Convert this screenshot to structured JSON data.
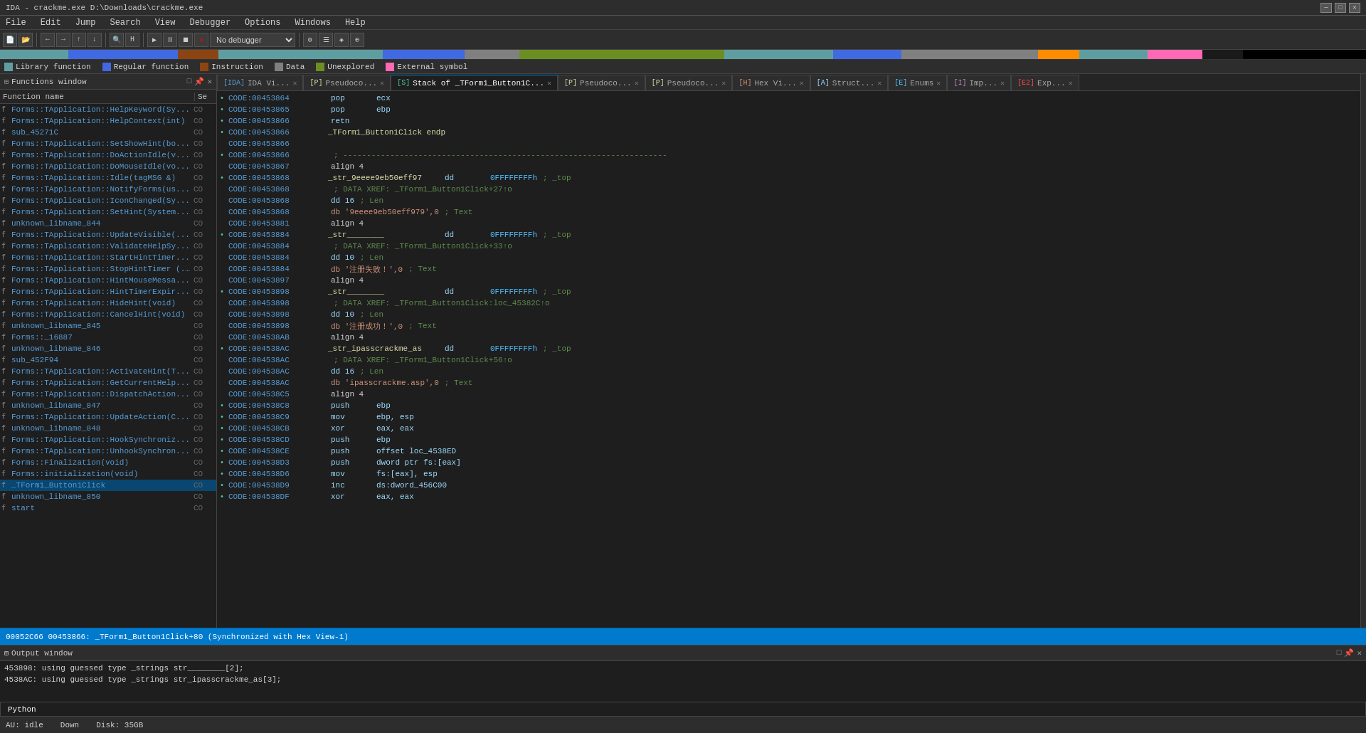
{
  "titlebar": {
    "title": "IDA - crackme.exe D:\\Downloads\\crackme.exe",
    "min": "─",
    "max": "□",
    "close": "✕"
  },
  "menubar": {
    "items": [
      "File",
      "Edit",
      "Jump",
      "Search",
      "View",
      "Debugger",
      "Options",
      "Windows",
      "Help"
    ]
  },
  "legend": {
    "items": [
      {
        "color": "#5f9ea0",
        "label": "Library function"
      },
      {
        "color": "#4169e1",
        "label": "Regular function"
      },
      {
        "color": "#8b4513",
        "label": "Instruction"
      },
      {
        "color": "#808080",
        "label": "Data"
      },
      {
        "color": "#6b8e23",
        "label": "Unexplored"
      },
      {
        "color": "#ff69b4",
        "label": "External symbol"
      }
    ]
  },
  "functions_panel": {
    "title": "Functions window",
    "col_name": "Function name",
    "col_se": "Se",
    "functions": [
      {
        "icon": "f",
        "name": "Forms::TApplication::HelpKeyword(Sy...",
        "se": "CO"
      },
      {
        "icon": "f",
        "name": "Forms::TApplication::HelpContext(int)",
        "se": "CO"
      },
      {
        "icon": "f",
        "name": "sub_45271C",
        "se": "CO"
      },
      {
        "icon": "f",
        "name": "Forms::TApplication::SetShowHint(bo...",
        "se": "CO"
      },
      {
        "icon": "f",
        "name": "Forms::TApplication::DoActionIdle(v...",
        "se": "CO"
      },
      {
        "icon": "f",
        "name": "Forms::TApplication::DoMouseIdle(vo...",
        "se": "CO"
      },
      {
        "icon": "f",
        "name": "Forms::TApplication::Idle(tagMSG &)",
        "se": "CO"
      },
      {
        "icon": "f",
        "name": "Forms::TApplication::NotifyForms(us...",
        "se": "CO"
      },
      {
        "icon": "f",
        "name": "Forms::TApplication::IconChanged(Sy...",
        "se": "CO"
      },
      {
        "icon": "f",
        "name": "Forms::TApplication::SetHint(System...",
        "se": "CO"
      },
      {
        "icon": "f",
        "name": "unknown_libname_844",
        "se": "CO"
      },
      {
        "icon": "f",
        "name": "Forms::TApplication::UpdateVisible(...",
        "se": "CO"
      },
      {
        "icon": "f",
        "name": "Forms::TApplication::ValidateHelpSy...",
        "se": "CO"
      },
      {
        "icon": "f",
        "name": "Forms::TApplication::StartHintTimer...",
        "se": "CO"
      },
      {
        "icon": "f",
        "name": "Forms::TApplication::StopHintTimer (...",
        "se": "CO"
      },
      {
        "icon": "f",
        "name": "Forms::TApplication::HintMouseMessa...",
        "se": "CO"
      },
      {
        "icon": "f",
        "name": "Forms::TApplication::HintTimerExpir...",
        "se": "CO"
      },
      {
        "icon": "f",
        "name": "Forms::TApplication::HideHint(void)",
        "se": "CO"
      },
      {
        "icon": "f",
        "name": "Forms::TApplication::CancelHint(void)",
        "se": "CO"
      },
      {
        "icon": "f",
        "name": "unknown_libname_845",
        "se": "CO"
      },
      {
        "icon": "f",
        "name": "Forms::_16887",
        "se": "CO"
      },
      {
        "icon": "f",
        "name": "unknown_libname_846",
        "se": "CO"
      },
      {
        "icon": "f",
        "name": "sub_452F94",
        "se": "CO"
      },
      {
        "icon": "f",
        "name": "Forms::TApplication::ActivateHint(T...",
        "se": "CO"
      },
      {
        "icon": "f",
        "name": "Forms::TApplication::GetCurrentHelp...",
        "se": "CO"
      },
      {
        "icon": "f",
        "name": "Forms::TApplication::DispatchAction...",
        "se": "CO"
      },
      {
        "icon": "f",
        "name": "unknown_libname_847",
        "se": "CO"
      },
      {
        "icon": "f",
        "name": "Forms::TApplication::UpdateAction(C...",
        "se": "CO"
      },
      {
        "icon": "f",
        "name": "unknown_libname_848",
        "se": "CO"
      },
      {
        "icon": "f",
        "name": "Forms::TApplication::HookSynchroniz...",
        "se": "CO"
      },
      {
        "icon": "f",
        "name": "Forms::TApplication::UnhookSynchron...",
        "se": "CO"
      },
      {
        "icon": "f",
        "name": "Forms::Finalization(void)",
        "se": "CO"
      },
      {
        "icon": "f",
        "name": "Forms::initialization(void)",
        "se": "CO"
      },
      {
        "icon": "f",
        "name": "_TForm1_Button1Click",
        "se": "CO",
        "selected": true
      },
      {
        "icon": "f",
        "name": "unknown_libname_850",
        "se": "CO"
      },
      {
        "icon": "f",
        "name": "start",
        "se": "CO"
      }
    ]
  },
  "tabs": [
    {
      "icon": "IDA",
      "label": "IDA Vi...",
      "active": false,
      "closeable": true
    },
    {
      "icon": "P",
      "label": "Pseudoco...",
      "active": false,
      "closeable": true
    },
    {
      "icon": "S",
      "label": "Stack of _TForm1_Button1C...",
      "active": true,
      "closeable": true
    },
    {
      "icon": "P",
      "label": "Pseudoco...",
      "active": false,
      "closeable": true
    },
    {
      "icon": "P",
      "label": "Pseudoco...",
      "active": false,
      "closeable": true
    },
    {
      "icon": "H",
      "label": "Hex Vi...",
      "active": false,
      "closeable": true
    },
    {
      "icon": "A",
      "label": "Struct...",
      "active": false,
      "closeable": true
    },
    {
      "icon": "E",
      "label": "Enums",
      "active": false,
      "closeable": true
    },
    {
      "icon": "I",
      "label": "Imp...",
      "active": false,
      "closeable": true
    },
    {
      "icon": "E2",
      "label": "Exp...",
      "active": false,
      "closeable": true
    }
  ],
  "code_lines": [
    {
      "dot": "•",
      "addr": "CODE:00453864",
      "label": "",
      "op": "pop",
      "arg": "ecx",
      "comment": ""
    },
    {
      "dot": "•",
      "addr": "CODE:00453865",
      "label": "",
      "op": "pop",
      "arg": "ebp",
      "comment": ""
    },
    {
      "dot": "•",
      "addr": "CODE:00453866",
      "label": "",
      "op": "retn",
      "arg": "",
      "comment": ""
    },
    {
      "dot": "•",
      "addr": "CODE:00453866",
      "label": "_TForm1_Button1Click endp",
      "op": "",
      "arg": "",
      "comment": ""
    },
    {
      "dot": "",
      "addr": "CODE:00453866",
      "label": "",
      "op": "",
      "arg": "",
      "comment": ""
    },
    {
      "dot": "•",
      "addr": "CODE:00453866",
      "label": "",
      "op": ";",
      "arg": "",
      "comment": "---------------------------------------------------------------------"
    },
    {
      "dot": "",
      "addr": "CODE:00453867",
      "label": "",
      "op": "",
      "arg": "align 4",
      "comment": ""
    },
    {
      "dot": "•",
      "addr": "CODE:00453868",
      "label": "_str_9eeee9eb50eff97",
      "op": "dd",
      "arg": "0FFFFFFFFh",
      "comment": "; _top"
    },
    {
      "dot": "",
      "addr": "CODE:00453868",
      "label": "",
      "op": "",
      "arg": "",
      "comment": "; DATA XREF: _TForm1_Button1Click+27↑o"
    },
    {
      "dot": "",
      "addr": "CODE:00453868",
      "label": "",
      "op": "",
      "arg": "dd 16",
      "comment": "; Len"
    },
    {
      "dot": "",
      "addr": "CODE:00453868",
      "label": "",
      "op": "",
      "arg": "db '9eeee9eb50eff979',0",
      "comment": "; Text"
    },
    {
      "dot": "",
      "addr": "CODE:00453881",
      "label": "",
      "op": "",
      "arg": "align 4",
      "comment": ""
    },
    {
      "dot": "•",
      "addr": "CODE:00453884",
      "label": "_str________",
      "op": "dd",
      "arg": "0FFFFFFFFh",
      "comment": "; _top"
    },
    {
      "dot": "",
      "addr": "CODE:00453884",
      "label": "",
      "op": "",
      "arg": "",
      "comment": "; DATA XREF: _TForm1_Button1Click+33↑o"
    },
    {
      "dot": "",
      "addr": "CODE:00453884",
      "label": "",
      "op": "",
      "arg": "dd 10",
      "comment": "; Len"
    },
    {
      "dot": "",
      "addr": "CODE:00453884",
      "label": "",
      "op": "",
      "arg": "db '注册失败！',0",
      "comment": "        ; Text"
    },
    {
      "dot": "",
      "addr": "CODE:00453897",
      "label": "",
      "op": "",
      "arg": "align 4",
      "comment": ""
    },
    {
      "dot": "•",
      "addr": "CODE:00453898",
      "label": "_str________",
      "op": "dd",
      "arg": "0FFFFFFFFh",
      "comment": "; _top"
    },
    {
      "dot": "",
      "addr": "CODE:00453898",
      "label": "",
      "op": "",
      "arg": "",
      "comment": "; DATA XREF: _TForm1_Button1Click:loc_45382C↑o"
    },
    {
      "dot": "",
      "addr": "CODE:00453898",
      "label": "",
      "op": "",
      "arg": "dd 10",
      "comment": "; Len"
    },
    {
      "dot": "",
      "addr": "CODE:00453898",
      "label": "",
      "op": "",
      "arg": "db '注册成功！',0",
      "comment": "        ; Text"
    },
    {
      "dot": "",
      "addr": "CODE:004538AB",
      "label": "",
      "op": "",
      "arg": "align 4",
      "comment": ""
    },
    {
      "dot": "•",
      "addr": "CODE:004538AC",
      "label": "_str_ipasscrackme_as",
      "op": "dd",
      "arg": "0FFFFFFFFh",
      "comment": "; _top"
    },
    {
      "dot": "",
      "addr": "CODE:004538AC",
      "label": "",
      "op": "",
      "arg": "",
      "comment": "; DATA XREF: _TForm1_Button1Click+56↑o"
    },
    {
      "dot": "",
      "addr": "CODE:004538AC",
      "label": "",
      "op": "",
      "arg": "dd 16",
      "comment": "; Len"
    },
    {
      "dot": "",
      "addr": "CODE:004538AC",
      "label": "",
      "op": "",
      "arg": "db 'ipasscrackme.asp',0",
      "comment": "; Text"
    },
    {
      "dot": "",
      "addr": "CODE:004538C5",
      "label": "",
      "op": "",
      "arg": "align 4",
      "comment": ""
    },
    {
      "dot": "•",
      "addr": "CODE:004538C8",
      "label": "",
      "op": "push",
      "arg": "ebp",
      "comment": ""
    },
    {
      "dot": "•",
      "addr": "CODE:004538C9",
      "label": "",
      "op": "mov",
      "arg": "ebp, esp",
      "comment": ""
    },
    {
      "dot": "•",
      "addr": "CODE:004538CB",
      "label": "",
      "op": "xor",
      "arg": "eax, eax",
      "comment": ""
    },
    {
      "dot": "•",
      "addr": "CODE:004538CD",
      "label": "",
      "op": "push",
      "arg": "ebp",
      "comment": ""
    },
    {
      "dot": "•",
      "addr": "CODE:004538CE",
      "label": "",
      "op": "push",
      "arg": "offset loc_4538ED",
      "comment": ""
    },
    {
      "dot": "•",
      "addr": "CODE:004538D3",
      "label": "",
      "op": "push",
      "arg": "dword ptr fs:[eax]",
      "comment": ""
    },
    {
      "dot": "•",
      "addr": "CODE:004538D6",
      "label": "",
      "op": "mov",
      "arg": "fs:[eax], esp",
      "comment": ""
    },
    {
      "dot": "•",
      "addr": "CODE:004538D9",
      "label": "",
      "op": "inc",
      "arg": "ds:dword_456C00",
      "comment": ""
    },
    {
      "dot": "•",
      "addr": "CODE:004538DF",
      "label": "",
      "op": "xor",
      "arg": "eax, eax",
      "comment": ""
    }
  ],
  "statusbar": {
    "text": "00052C66 00453866: _TForm1_Button1Click+80 (Synchronized with Hex View-1)"
  },
  "output": {
    "title": "Output window",
    "lines": [
      "453898: using guessed type _strings str________[2];",
      "4538AC: using guessed type _strings str_ipasscrackme_as[3];"
    ]
  },
  "bottom_tabs": [
    "Python"
  ],
  "footer": {
    "status": "AU: idle",
    "direction": "Down",
    "disk": "Disk: 35GB"
  },
  "debugger": {
    "label": "No debugger"
  }
}
